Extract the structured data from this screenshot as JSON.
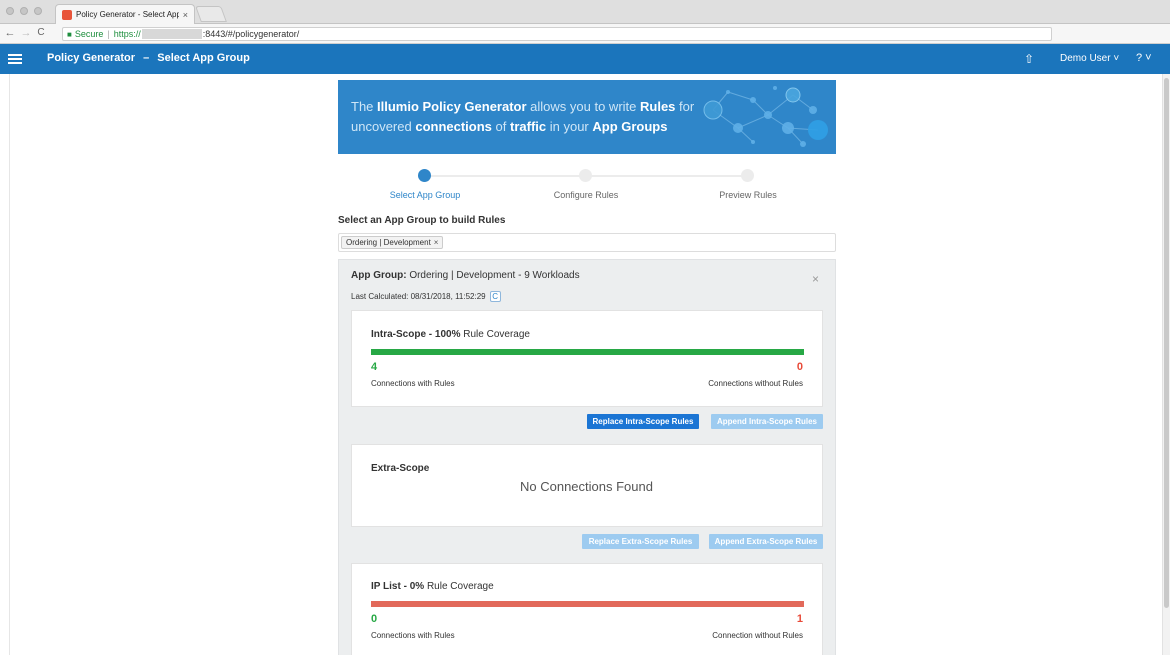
{
  "browser": {
    "tab_title": "Policy Generator - Select App",
    "tab_close": "×",
    "secure_label": "Secure",
    "separator": "|",
    "url_scheme": "https://",
    "url_rest": ":8443/#/policygenerator/",
    "nav_back": "←",
    "nav_forward": "→",
    "nav_reload": "C",
    "star": "☆",
    "menu": "⋮"
  },
  "appbar": {
    "title": "Policy Generator",
    "dash": "–",
    "subtitle": "Select App Group",
    "upload_icon": "⇧",
    "user": "Demo User ˅",
    "help": "? ˅"
  },
  "banner": {
    "text_parts": [
      "The ",
      "Illumio Policy Generator",
      " allows you to write ",
      "Rules",
      " for ",
      "uncovered",
      " ",
      "connections",
      " of ",
      "traffic",
      " in your ",
      "App Groups"
    ]
  },
  "steps": [
    {
      "label": "Select App Group",
      "active": true
    },
    {
      "label": "Configure Rules",
      "active": false
    },
    {
      "label": "Preview Rules",
      "active": false
    }
  ],
  "selector": {
    "heading": "Select an App Group to build Rules",
    "chip": "Ordering | Development",
    "chip_remove": "×"
  },
  "app_group": {
    "title_label": "App Group:",
    "title_value": " Ordering | Development - 9 Workloads",
    "close": "×",
    "last_calculated": "Last Calculated: 08/31/2018, 11:52:29",
    "refresh": "C"
  },
  "intra_scope": {
    "title_bold": "Intra-Scope - 100%",
    "title_rest": " Rule Coverage",
    "coverage_percent": 100,
    "with_rules_count": "4",
    "with_rules_label": "Connections with Rules",
    "without_rules_count": "0",
    "without_rules_label": "Connections without Rules",
    "replace_button": "Replace Intra-Scope Rules",
    "append_button": "Append Intra-Scope Rules"
  },
  "extra_scope": {
    "title": "Extra-Scope",
    "empty_text": "No Connections Found",
    "replace_button": "Replace Extra-Scope Rules",
    "append_button": "Append Extra-Scope Rules"
  },
  "ip_list": {
    "title_bold": "IP List - 0%",
    "title_rest": " Rule Coverage",
    "coverage_percent": 0,
    "with_rules_count": "0",
    "with_rules_label": "Connections with Rules",
    "without_rules_count": "1",
    "without_rules_label": "Connection without Rules"
  },
  "colors": {
    "appbar": "#1b75bc",
    "covered": "#27a845",
    "uncovered": "#e2695a",
    "primary_button": "#1b75d4"
  }
}
